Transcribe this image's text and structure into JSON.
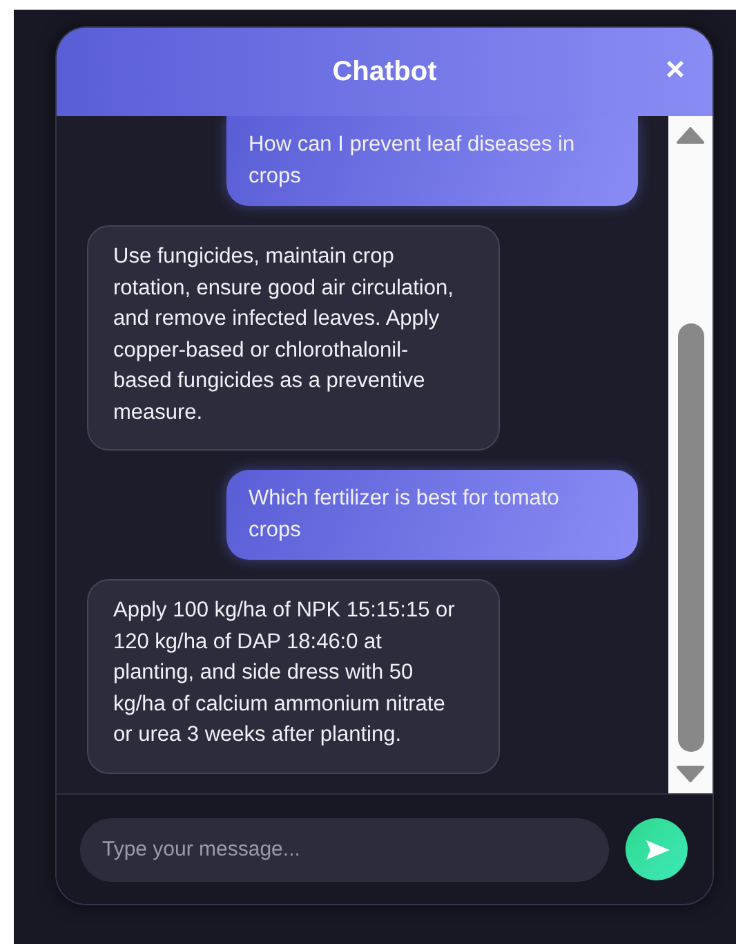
{
  "window": {
    "title": "Chatbot",
    "close": "×"
  },
  "messages": [
    {
      "kind": "user",
      "text": "How can I prevent leaf diseases in crops"
    },
    {
      "kind": "bot",
      "text": "Use fungicides, maintain crop rotation, ensure good air circulation, and remove infected leaves. Apply copper-based or chlorothalonil-based fungicides as a preventive measure."
    },
    {
      "kind": "user",
      "text": "Which fertilizer is best for tomato crops"
    },
    {
      "kind": "bot",
      "text": "Apply 100 kg/ha of NPK 15:15:15 or 120 kg/ha of DAP 18:46:0 at planting, and side dress with 50 kg/ha of calcium ammonium nitrate or urea 3 weeks after planting."
    }
  ],
  "input": {
    "placeholder": "Type your message..."
  }
}
